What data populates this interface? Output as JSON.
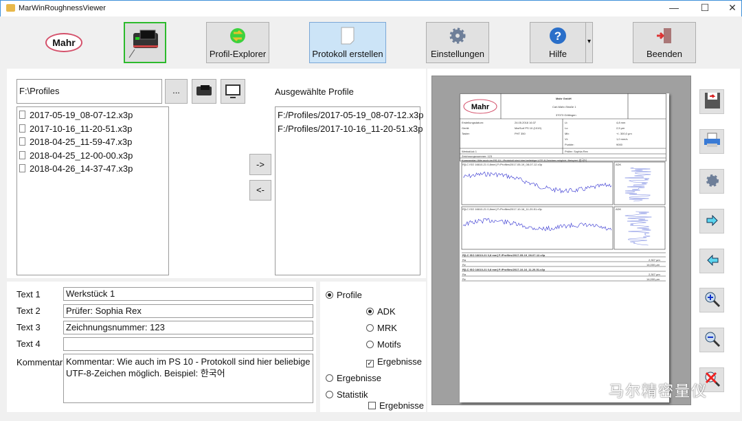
{
  "window": {
    "title": "MarWinRoughnessViewer",
    "minimize": "—",
    "maximize": "☐",
    "close": "✕"
  },
  "toolbar": {
    "logo": "Mahr",
    "profile_explorer": "Profil-Explorer",
    "create_report": "Protokoll erstellen",
    "settings": "Einstellungen",
    "help": "Hilfe",
    "exit": "Beenden",
    "help_dropdown": "▾"
  },
  "profiles": {
    "path": "F:\\Profiles",
    "browse": "...",
    "files": [
      "2017-05-19_08-07-12.x3p",
      "2017-10-16_11-20-51.x3p",
      "2018-04-25_11-59-47.x3p",
      "2018-04-25_12-00-00.x3p",
      "2018-04-26_14-37-47.x3p"
    ],
    "add": "->",
    "remove": "<-",
    "selected_label": "Ausgewählte Profile",
    "selected": [
      "F:/Profiles/2017-05-19_08-07-12.x3p",
      "F:/Profiles/2017-10-16_11-20-51.x3p"
    ]
  },
  "fields": {
    "text1_label": "Text 1",
    "text1": "Werkstück 1",
    "text2_label": "Text 2",
    "text2": "Prüfer: Sophia Rex",
    "text3_label": "Text 3",
    "text3": "Zeichnungsnummer: 123",
    "text4_label": "Text 4",
    "text4": "",
    "comment_label": "Kommentar",
    "comment": "Kommentar: Wie auch im PS 10 - Protokoll sind hier beliebige UTF-8-Zeichen möglich. Beispiel: 한국어"
  },
  "options": {
    "profile": "Profile",
    "adk": "ADK",
    "mrk": "MRK",
    "motifs": "Motifs",
    "results_sub": "Ergebnisse",
    "results": "Ergebnisse",
    "statistics": "Statistik",
    "stat_results": "Ergebnisse",
    "selected_mode": "Profile",
    "selected_view": "ADK",
    "results_sub_checked": true,
    "stat_results_checked": false
  },
  "report": {
    "company": "Mahr GmbH",
    "street": "Carl-Mahr-Straße 1",
    "city": "37073 Göttingen",
    "created_label": "Erstellungsdatum:",
    "created": "24.05.2018 16:37",
    "device_label": "Gerät:",
    "device": "MarSurf PS 10 (1019)",
    "probe_label": "Taster:",
    "probe": "PHT 350",
    "lt_label": "Lt:",
    "lt": "4,8 mm",
    "lc_label": "Lc:",
    "lc": "2,5 µm",
    "range_label": "Mb:",
    "range": "+/- 300,0 µm",
    "vt_label": "Vt:",
    "vt": "1,0 mm/s",
    "points_label": "Punkte:",
    "points": "9000",
    "workpiece": "Werkstück 1",
    "inspector": "Prüfer: Sophia Rex",
    "drawing": "Zeichnungsnummer: 123",
    "comment": "Kommentar: Wie auch im PS 10 - Protokoll sind hier beliebige UTF-8-Zeichen möglich. Beispiel: 한국어",
    "profile1": "R[LC ISO 16610-21 0,8mm] F:/Profiles/2017-05-19_08-07-12.x3p",
    "profile2": "R[LC ISO 16610-21 0,8mm] F:/Profiles/2017-10-16_11-20-51.x3p",
    "adk": "ADK",
    "res1": "R[LC ISO 16610-21 0,8 mm] F:/Profiles/2017-05-19_08-07-12.x3p",
    "res2": "R[LC ISO 16610-21 0,8 mm] F:/Profiles/2017-10-16_11-20-51.x3p",
    "ra": "Ra",
    "ra1": "2,307 µm",
    "rz": "Rz",
    "rz1": "14,000 µm",
    "ra2": "2,307 µm",
    "rz2": "14,000 µm"
  },
  "side": {
    "save": "save-icon",
    "print": "printer-icon",
    "settings": "gear-icon",
    "next": "arrow-right-icon",
    "prev": "arrow-left-icon",
    "zoom_in": "zoom-in-icon",
    "zoom_out": "zoom-out-icon",
    "zoom_reset": "zoom-reset-icon"
  },
  "watermark": "马尔精密量仪",
  "colors": {
    "accent": "#cce4f7",
    "profile_line": "#3030d0",
    "logo_ring": "#d4506a"
  }
}
